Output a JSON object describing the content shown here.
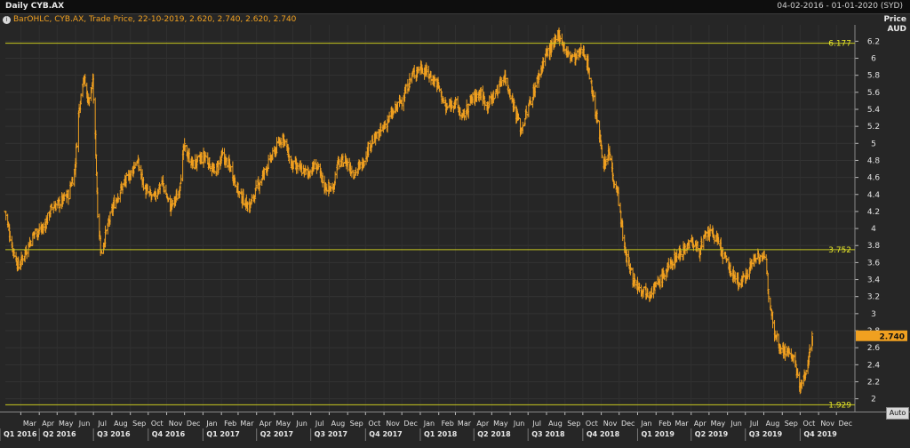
{
  "header": {
    "title": "Daily CYB.AX",
    "date_range": "04-02-2016 - 01-01-2020 (SYD)"
  },
  "legend": {
    "icon": "info-circle-icon",
    "text": "BarOHLC, CYB.AX, Trade Price, 22-10-2019, 2.620, 2.740, 2.620, 2.740"
  },
  "price_axis": {
    "label_top": "Price",
    "label_unit": "AUD"
  },
  "auto_button": "Auto",
  "colors": {
    "bars": "#f0a020",
    "hlines": "#c8c820",
    "background": "#262626",
    "last_price_bg": "#f0a020"
  },
  "chart_data": {
    "type": "bar",
    "subtype": "ohlc",
    "x_start": "2016-02-04",
    "x_end": "2020-01-01",
    "ylim": [
      1.85,
      6.35
    ],
    "yticks": [
      2,
      2.2,
      2.4,
      2.6,
      2.8,
      3,
      3.2,
      3.4,
      3.6,
      3.8,
      4,
      4.2,
      4.4,
      4.6,
      4.8,
      5,
      5.2,
      5.4,
      5.6,
      5.8,
      6,
      6.2
    ],
    "ytick_labels": [
      "2",
      "2.2",
      "2.4",
      "2.6",
      "2.8",
      "3",
      "3.2",
      "3.4",
      "3.6",
      "3.8",
      "4",
      "4.2",
      "4.4",
      "4.6",
      "4.8",
      "5",
      "5.2",
      "5.4",
      "5.6",
      "5.8",
      "6",
      "6.2"
    ],
    "x_month_ticks": [
      {
        "date": "2016-03-01",
        "label": "Mar"
      },
      {
        "date": "2016-04-01",
        "label": "Apr"
      },
      {
        "date": "2016-05-01",
        "label": "May"
      },
      {
        "date": "2016-06-01",
        "label": "Jun"
      },
      {
        "date": "2016-07-01",
        "label": "Jul"
      },
      {
        "date": "2016-08-01",
        "label": "Aug"
      },
      {
        "date": "2016-09-01",
        "label": "Sep"
      },
      {
        "date": "2016-10-01",
        "label": "Oct"
      },
      {
        "date": "2016-11-01",
        "label": "Nov"
      },
      {
        "date": "2016-12-01",
        "label": "Dec"
      },
      {
        "date": "2017-01-01",
        "label": "Jan"
      },
      {
        "date": "2017-02-01",
        "label": "Feb"
      },
      {
        "date": "2017-03-01",
        "label": "Mar"
      },
      {
        "date": "2017-04-01",
        "label": "Apr"
      },
      {
        "date": "2017-05-01",
        "label": "May"
      },
      {
        "date": "2017-06-01",
        "label": "Jun"
      },
      {
        "date": "2017-07-01",
        "label": "Jul"
      },
      {
        "date": "2017-08-01",
        "label": "Aug"
      },
      {
        "date": "2017-09-01",
        "label": "Sep"
      },
      {
        "date": "2017-10-01",
        "label": "Oct"
      },
      {
        "date": "2017-11-01",
        "label": "Nov"
      },
      {
        "date": "2017-12-01",
        "label": "Dec"
      },
      {
        "date": "2018-01-01",
        "label": "Jan"
      },
      {
        "date": "2018-02-01",
        "label": "Feb"
      },
      {
        "date": "2018-03-01",
        "label": "Mar"
      },
      {
        "date": "2018-04-01",
        "label": "Apr"
      },
      {
        "date": "2018-05-01",
        "label": "May"
      },
      {
        "date": "2018-06-01",
        "label": "Jun"
      },
      {
        "date": "2018-07-01",
        "label": "Jul"
      },
      {
        "date": "2018-08-01",
        "label": "Aug"
      },
      {
        "date": "2018-09-01",
        "label": "Sep"
      },
      {
        "date": "2018-10-01",
        "label": "Oct"
      },
      {
        "date": "2018-11-01",
        "label": "Nov"
      },
      {
        "date": "2018-12-01",
        "label": "Dec"
      },
      {
        "date": "2019-01-01",
        "label": "Jan"
      },
      {
        "date": "2019-02-01",
        "label": "Feb"
      },
      {
        "date": "2019-03-01",
        "label": "Mar"
      },
      {
        "date": "2019-04-01",
        "label": "Apr"
      },
      {
        "date": "2019-05-01",
        "label": "May"
      },
      {
        "date": "2019-06-01",
        "label": "Jun"
      },
      {
        "date": "2019-07-01",
        "label": "Jul"
      },
      {
        "date": "2019-08-01",
        "label": "Aug"
      },
      {
        "date": "2019-09-01",
        "label": "Sep"
      },
      {
        "date": "2019-10-01",
        "label": "Oct"
      },
      {
        "date": "2019-11-01",
        "label": "Nov"
      },
      {
        "date": "2019-12-01",
        "label": "Dec"
      }
    ],
    "x_quarter_ticks": [
      {
        "date": "2016-01-01",
        "label": "Q1 2016"
      },
      {
        "date": "2016-04-01",
        "label": "Q2 2016"
      },
      {
        "date": "2016-07-01",
        "label": "Q3 2016"
      },
      {
        "date": "2016-10-01",
        "label": "Q4 2016"
      },
      {
        "date": "2017-01-01",
        "label": "Q1 2017"
      },
      {
        "date": "2017-04-01",
        "label": "Q2 2017"
      },
      {
        "date": "2017-07-01",
        "label": "Q3 2017"
      },
      {
        "date": "2017-10-01",
        "label": "Q4 2017"
      },
      {
        "date": "2018-01-01",
        "label": "Q1 2018"
      },
      {
        "date": "2018-04-01",
        "label": "Q2 2018"
      },
      {
        "date": "2018-07-01",
        "label": "Q3 2018"
      },
      {
        "date": "2018-10-01",
        "label": "Q4 2018"
      },
      {
        "date": "2019-01-01",
        "label": "Q1 2019"
      },
      {
        "date": "2019-04-01",
        "label": "Q2 2019"
      },
      {
        "date": "2019-07-01",
        "label": "Q3 2019"
      },
      {
        "date": "2019-10-01",
        "label": "Q4 2019"
      }
    ],
    "hlines": [
      {
        "value": 6.177,
        "label": "6.177"
      },
      {
        "value": 3.752,
        "label": "3.752"
      },
      {
        "value": 1.929,
        "label": "1.929"
      }
    ],
    "last_price": {
      "value": 2.74,
      "label": "2.740"
    },
    "anchors": [
      [
        "2016-02-04",
        4.2
      ],
      [
        "2016-02-15",
        3.8
      ],
      [
        "2016-02-26",
        3.55
      ],
      [
        "2016-03-10",
        3.75
      ],
      [
        "2016-03-24",
        3.95
      ],
      [
        "2016-04-08",
        4.0
      ],
      [
        "2016-04-22",
        4.25
      ],
      [
        "2016-05-06",
        4.3
      ],
      [
        "2016-05-20",
        4.4
      ],
      [
        "2016-05-31",
        4.7
      ],
      [
        "2016-06-06",
        5.35
      ],
      [
        "2016-06-14",
        5.8
      ],
      [
        "2016-06-22",
        5.5
      ],
      [
        "2016-06-30",
        5.7
      ],
      [
        "2016-07-05",
        4.9
      ],
      [
        "2016-07-08",
        4.2
      ],
      [
        "2016-07-14",
        3.7
      ],
      [
        "2016-07-22",
        3.95
      ],
      [
        "2016-08-05",
        4.3
      ],
      [
        "2016-08-19",
        4.5
      ],
      [
        "2016-09-02",
        4.65
      ],
      [
        "2016-09-12",
        4.8
      ],
      [
        "2016-09-26",
        4.45
      ],
      [
        "2016-10-10",
        4.35
      ],
      [
        "2016-10-24",
        4.55
      ],
      [
        "2016-11-07",
        4.25
      ],
      [
        "2016-11-21",
        4.4
      ],
      [
        "2016-11-30",
        4.95
      ],
      [
        "2016-12-15",
        4.75
      ],
      [
        "2017-01-05",
        4.85
      ],
      [
        "2017-01-20",
        4.65
      ],
      [
        "2017-02-03",
        4.85
      ],
      [
        "2017-02-17",
        4.7
      ],
      [
        "2017-03-03",
        4.4
      ],
      [
        "2017-03-20",
        4.25
      ],
      [
        "2017-04-03",
        4.5
      ],
      [
        "2017-04-20",
        4.75
      ],
      [
        "2017-05-05",
        4.95
      ],
      [
        "2017-05-15",
        5.1
      ],
      [
        "2017-05-29",
        4.75
      ],
      [
        "2017-06-12",
        4.7
      ],
      [
        "2017-06-26",
        4.65
      ],
      [
        "2017-07-10",
        4.75
      ],
      [
        "2017-07-24",
        4.5
      ],
      [
        "2017-08-07",
        4.45
      ],
      [
        "2017-08-14",
        4.75
      ],
      [
        "2017-08-28",
        4.8
      ],
      [
        "2017-09-11",
        4.65
      ],
      [
        "2017-09-25",
        4.75
      ],
      [
        "2017-10-09",
        5.0
      ],
      [
        "2017-10-23",
        5.1
      ],
      [
        "2017-11-06",
        5.25
      ],
      [
        "2017-11-20",
        5.4
      ],
      [
        "2017-12-04",
        5.55
      ],
      [
        "2017-12-18",
        5.8
      ],
      [
        "2018-01-02",
        5.9
      ],
      [
        "2018-01-16",
        5.8
      ],
      [
        "2018-01-30",
        5.7
      ],
      [
        "2018-02-13",
        5.4
      ],
      [
        "2018-02-27",
        5.5
      ],
      [
        "2018-03-13",
        5.3
      ],
      [
        "2018-03-27",
        5.5
      ],
      [
        "2018-04-10",
        5.6
      ],
      [
        "2018-04-24",
        5.45
      ],
      [
        "2018-05-08",
        5.6
      ],
      [
        "2018-05-22",
        5.8
      ],
      [
        "2018-06-05",
        5.5
      ],
      [
        "2018-06-19",
        5.15
      ],
      [
        "2018-07-03",
        5.45
      ],
      [
        "2018-07-17",
        5.75
      ],
      [
        "2018-07-31",
        6.05
      ],
      [
        "2018-08-14",
        6.15
      ],
      [
        "2018-08-21",
        6.3
      ],
      [
        "2018-09-04",
        6.05
      ],
      [
        "2018-09-18",
        6.0
      ],
      [
        "2018-10-02",
        6.1
      ],
      [
        "2018-10-10",
        5.9
      ],
      [
        "2018-10-24",
        5.3
      ],
      [
        "2018-11-07",
        4.7
      ],
      [
        "2018-11-14",
        4.9
      ],
      [
        "2018-11-21",
        4.6
      ],
      [
        "2018-11-28",
        4.45
      ],
      [
        "2018-12-10",
        3.75
      ],
      [
        "2018-12-24",
        3.4
      ],
      [
        "2019-01-07",
        3.3
      ],
      [
        "2019-01-21",
        3.25
      ],
      [
        "2019-02-04",
        3.35
      ],
      [
        "2019-02-18",
        3.5
      ],
      [
        "2019-03-04",
        3.65
      ],
      [
        "2019-03-18",
        3.75
      ],
      [
        "2019-04-01",
        3.85
      ],
      [
        "2019-04-15",
        3.75
      ],
      [
        "2019-04-29",
        3.95
      ],
      [
        "2019-05-13",
        3.9
      ],
      [
        "2019-05-27",
        3.65
      ],
      [
        "2019-06-10",
        3.45
      ],
      [
        "2019-06-24",
        3.35
      ],
      [
        "2019-07-08",
        3.55
      ],
      [
        "2019-07-22",
        3.7
      ],
      [
        "2019-08-05",
        3.6
      ],
      [
        "2019-08-09",
        3.25
      ],
      [
        "2019-08-19",
        2.8
      ],
      [
        "2019-08-29",
        2.6
      ],
      [
        "2019-09-09",
        2.55
      ],
      [
        "2019-09-19",
        2.5
      ],
      [
        "2019-09-30",
        2.15
      ],
      [
        "2019-10-09",
        2.25
      ],
      [
        "2019-10-22",
        2.74
      ]
    ]
  }
}
